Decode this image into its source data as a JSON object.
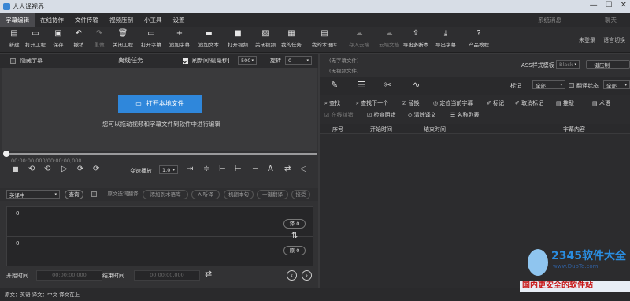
{
  "app": {
    "title": "人人译视界"
  },
  "menu": {
    "items": [
      "字幕编辑",
      "在线协作",
      "文件传输",
      "视频压制",
      "小工具",
      "设置"
    ],
    "system_msg": "系统消息",
    "chat": "聊天"
  },
  "toolbar": {
    "items": [
      {
        "label": "新建",
        "icon": "file-plus-icon",
        "glyph": "▤"
      },
      {
        "label": "打开工程",
        "icon": "folder-open-icon",
        "glyph": "▭"
      },
      {
        "label": "保存",
        "icon": "save-icon",
        "glyph": "▣"
      },
      {
        "label": "撤销",
        "icon": "undo-icon",
        "glyph": "↶"
      },
      {
        "label": "重做",
        "icon": "redo-icon",
        "glyph": "↷"
      },
      {
        "label": "关闭工程",
        "icon": "trash-icon",
        "glyph": "🗑"
      },
      {
        "label": "打开字幕",
        "icon": "folder-icon",
        "glyph": "▭"
      },
      {
        "label": "追加字幕",
        "icon": "plus-icon",
        "glyph": "+"
      },
      {
        "label": "追加文本",
        "icon": "text-icon",
        "glyph": "▬"
      },
      {
        "label": "打开视频",
        "icon": "video-icon",
        "glyph": "■"
      },
      {
        "label": "关闭视频",
        "icon": "video-off-icon",
        "glyph": "▨"
      },
      {
        "label": "我的任务",
        "icon": "task-icon",
        "glyph": "▦"
      },
      {
        "label": "我的术语库",
        "icon": "glossary-icon",
        "glyph": "▤"
      },
      {
        "label": "存入云端",
        "icon": "cloud-upload-icon",
        "glyph": "☁"
      },
      {
        "label": "云端文档",
        "icon": "cloud-doc-icon",
        "glyph": "☁"
      },
      {
        "label": "导出多断本",
        "icon": "export-multi-icon",
        "glyph": "⇪"
      },
      {
        "label": "导出字幕",
        "icon": "export-subtitle-icon",
        "glyph": "⤓"
      },
      {
        "label": "产品教程",
        "icon": "help-icon",
        "glyph": "?"
      }
    ],
    "login": "未登录",
    "language_switch": "语言切换"
  },
  "left": {
    "hide_subtitle": "隐藏字幕",
    "offline_task": "离线任务",
    "refresh_label": "刷新间隔[毫秒]",
    "refresh_value": "500",
    "rotate_label": "旋转",
    "rotate_value": "0",
    "open_local_file": "打开本地文件",
    "drag_hint": "您可以拖动视频和字幕文件到软件中进行编辑",
    "timecode": "00:00:00,000/00:00:00,000",
    "speed_label": "变速播放",
    "speed_value": "1.0",
    "trans_mode": "英译中",
    "lookup": "查询",
    "pills": [
      "原文选词翻译",
      "添加到术语库",
      "AI听译",
      "机翻本句",
      "一键翻译",
      "接受"
    ],
    "row1_index": "0",
    "row2_index": "0",
    "translation_count": "译 0",
    "original_count": "原 0",
    "start_time_label": "开始时间",
    "start_time_value": "00:00:00,000",
    "end_time_label": "结束时间",
    "end_time_value": "00:00:00,000"
  },
  "right": {
    "no_subtitle_file": "(无字幕文件)",
    "no_video_file": "(无视频文件)",
    "ass_template_label": "ASS样式模板",
    "ass_template_value": "Black",
    "one_click_suppress": "一键压制",
    "mark_label": "标记",
    "mark_value": "全部",
    "trans_status_label": "翻译状态",
    "trans_status_value": "全部",
    "tools_row1": [
      "查找",
      "查找下一个",
      "替换",
      "定位当前字幕",
      "标记",
      "取消标记",
      "推敲",
      "术语"
    ],
    "tools_row2": [
      "在线纠错",
      "检查阴错",
      "清除译文",
      "名称列表"
    ],
    "columns": [
      "序号",
      "开始时间",
      "结束时间",
      "字幕内容"
    ]
  },
  "status": {
    "text": "原文：英语   译文：中文   译文在上"
  },
  "watermark": {
    "brand": "2345软件大全",
    "url": "www.DuoTe.com",
    "slogan": "国内更安全的软件站"
  }
}
